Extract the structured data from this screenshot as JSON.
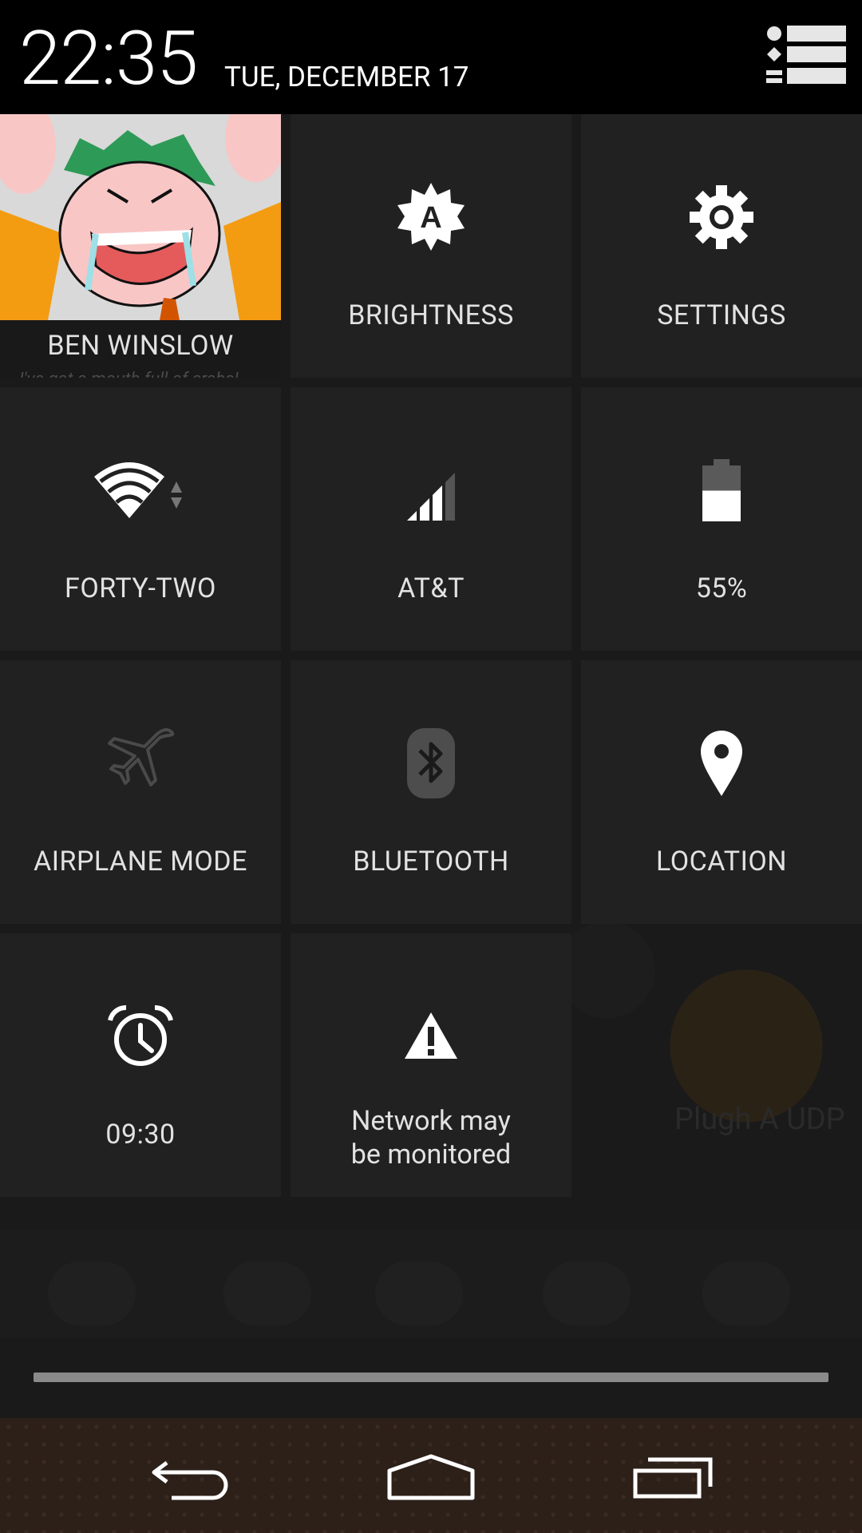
{
  "status": {
    "time": "22:35",
    "date": "TUE, DECEMBER 17",
    "notifications_icon": "notifications-list-icon"
  },
  "tiles": {
    "user": {
      "name": "BEN WINSLOW",
      "status": "I've got a mouth full of crabs!",
      "icon": "avatar"
    },
    "brightness": {
      "label": "BRIGHTNESS",
      "icon": "brightness-auto-icon"
    },
    "settings": {
      "label": "SETTINGS",
      "icon": "gear-icon"
    },
    "wifi": {
      "label": "FORTY-TWO",
      "icon": "wifi-icon"
    },
    "mobile": {
      "label": "AT&T",
      "icon": "signal-icon"
    },
    "battery": {
      "label": "55%",
      "icon": "battery-icon",
      "level": 0.55
    },
    "airplane": {
      "label": "AIRPLANE MODE",
      "icon": "airplane-icon",
      "enabled": false
    },
    "bluetooth": {
      "label": "BLUETOOTH",
      "icon": "bluetooth-icon",
      "enabled": false
    },
    "location": {
      "label": "LOCATION",
      "icon": "location-pin-icon"
    },
    "alarm": {
      "label": "09:30",
      "icon": "alarm-clock-icon"
    },
    "network_warning": {
      "line1": "Network may",
      "line2": "be monitored",
      "icon": "warning-icon"
    }
  },
  "background": {
    "app_label": "Plugh A UDP"
  },
  "navbar": {
    "back_icon": "back-icon",
    "home_icon": "home-icon",
    "recents_icon": "recents-icon"
  },
  "colors": {
    "tile_bg": "#212121",
    "header_bg": "#000000",
    "navbar_bg": "#2c2019"
  }
}
